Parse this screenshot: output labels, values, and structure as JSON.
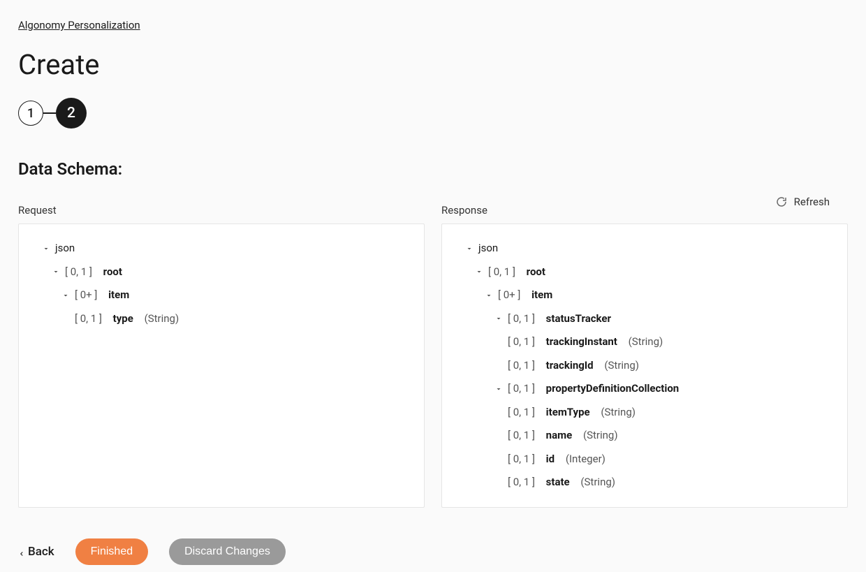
{
  "breadcrumb": "Algonomy Personalization",
  "page_title": "Create",
  "stepper": {
    "step1": "1",
    "step2": "2"
  },
  "section_title": "Data Schema:",
  "refresh_label": "Refresh",
  "request_label": "Request",
  "response_label": "Response",
  "request_tree": {
    "json": "json",
    "root_card": "[ 0, 1 ]",
    "root_name": "root",
    "item_card": "[ 0+ ]",
    "item_name": "item",
    "type_card": "[ 0, 1 ]",
    "type_name": "type",
    "type_dtype": "(String)"
  },
  "response_tree": {
    "json": "json",
    "root_card": "[ 0, 1 ]",
    "root_name": "root",
    "item_card": "[ 0+ ]",
    "item_name": "item",
    "statusTracker_card": "[ 0, 1 ]",
    "statusTracker_name": "statusTracker",
    "trackingInstant_card": "[ 0, 1 ]",
    "trackingInstant_name": "trackingInstant",
    "trackingInstant_dtype": "(String)",
    "trackingId_card": "[ 0, 1 ]",
    "trackingId_name": "trackingId",
    "trackingId_dtype": "(String)",
    "propertyDef_card": "[ 0, 1 ]",
    "propertyDef_name": "propertyDefinitionCollection",
    "itemType_card": "[ 0, 1 ]",
    "itemType_name": "itemType",
    "itemType_dtype": "(String)",
    "name_card": "[ 0, 1 ]",
    "name_name": "name",
    "name_dtype": "(String)",
    "id_card": "[ 0, 1 ]",
    "id_name": "id",
    "id_dtype": "(Integer)",
    "state_card": "[ 0, 1 ]",
    "state_name": "state",
    "state_dtype": "(String)"
  },
  "footer": {
    "back": "Back",
    "finished": "Finished",
    "discard": "Discard Changes"
  }
}
